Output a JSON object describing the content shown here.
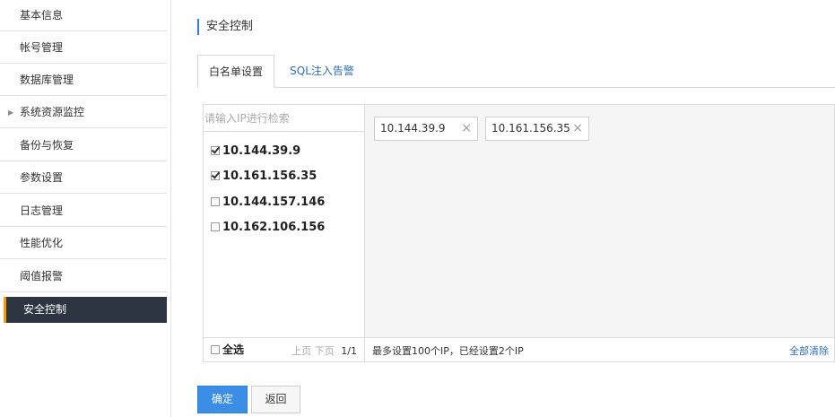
{
  "sidebar": {
    "items": [
      {
        "label": "基本信息"
      },
      {
        "label": "帐号管理"
      },
      {
        "label": "数据库管理"
      },
      {
        "label": "系统资源监控"
      },
      {
        "label": "备份与恢复"
      },
      {
        "label": "参数设置"
      },
      {
        "label": "日志管理"
      },
      {
        "label": "性能优化"
      },
      {
        "label": "阈值报警"
      },
      {
        "label": "安全控制"
      }
    ],
    "active_index": 9,
    "accent_color": "#f0a000"
  },
  "header": {
    "title": "安全控制"
  },
  "tabs": [
    {
      "label": "白名单设置",
      "active": true
    },
    {
      "label": "SQL注入告警",
      "active": false
    }
  ],
  "whitelist": {
    "search_placeholder": "请输入IP进行检索",
    "ip_list": [
      {
        "ip": "10.144.39.9",
        "checked": true
      },
      {
        "ip": "10.161.156.35",
        "checked": true
      },
      {
        "ip": "10.144.157.146",
        "checked": false
      },
      {
        "ip": "10.162.106.156",
        "checked": false
      }
    ],
    "selected": [
      "10.144.39.9",
      "10.161.156.35"
    ],
    "select_all_label": "全选",
    "pager": {
      "prev": "上页",
      "next": "下页",
      "page": "1/1"
    },
    "limit_text": "最多设置100个IP，已经设置2个IP",
    "clear_all_label": "全部清除",
    "remove_icon": "×"
  },
  "actions": {
    "confirm_label": "确定",
    "back_label": "返回"
  },
  "colors": {
    "primary": "#3a8ee6",
    "link": "#2f6fb6",
    "sidebar_active_bg": "#2d3442"
  }
}
